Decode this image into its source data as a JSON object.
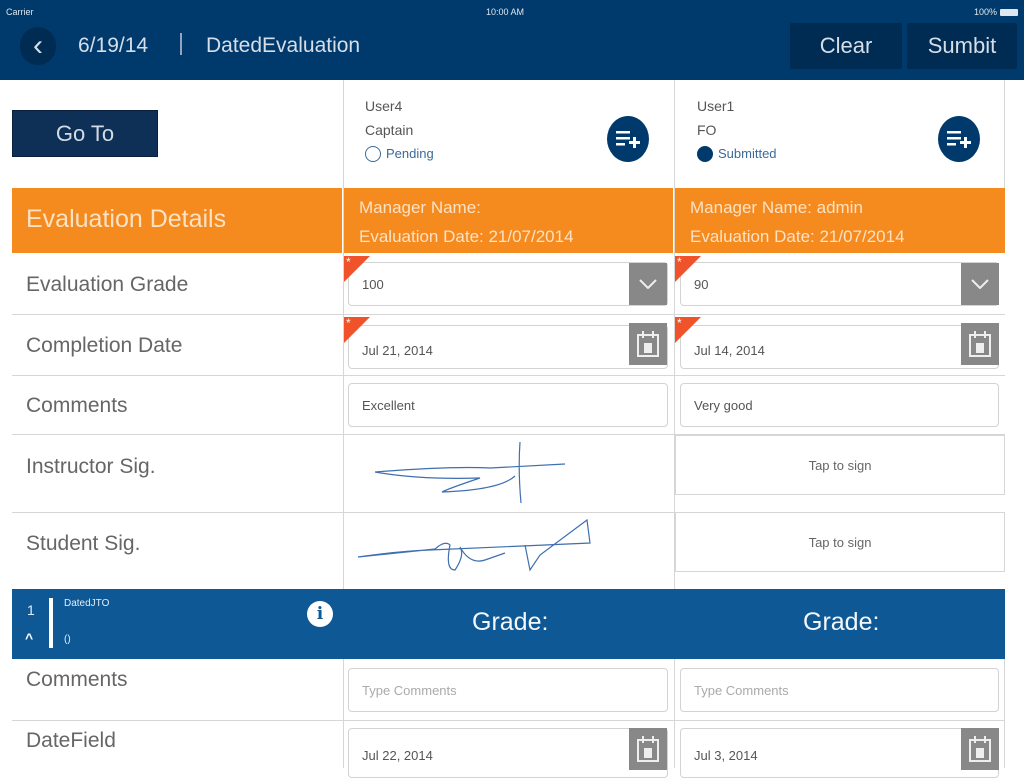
{
  "status_bar": {
    "carrier": "Carrier",
    "time": "10:00 AM",
    "battery": "100%"
  },
  "nav": {
    "date": "6/19/14",
    "title": "DatedEvaluation",
    "clear_label": "Clear",
    "submit_label": "Sumbit"
  },
  "goto_label": "Go To",
  "users": [
    {
      "name": "User4",
      "role": "Captain",
      "status": "Pending",
      "manager": "Manager Name:",
      "eval_date": "Evaluation Date: 21/07/2014"
    },
    {
      "name": "User1",
      "role": "FO",
      "status": "Submitted",
      "manager": "Manager Name: admin",
      "eval_date": "Evaluation Date: 21/07/2014"
    }
  ],
  "section_title": "Evaluation Details",
  "rows": {
    "grade": {
      "label": "Evaluation Grade",
      "values": [
        "100",
        "90"
      ]
    },
    "completion": {
      "label": "Completion Date",
      "values": [
        "Jul 21, 2014",
        "Jul 14, 2014"
      ]
    },
    "comments": {
      "label": "Comments",
      "values": [
        "Excellent",
        "Very good"
      ]
    },
    "instructor_sig": {
      "label": "Instructor Sig.",
      "tap_text": "Tap to sign"
    },
    "student_sig": {
      "label": "Student Sig.",
      "tap_text": "Tap to sign"
    }
  },
  "required_marker": "*",
  "subsection": {
    "number": "1",
    "name": "DatedJTO",
    "sub": "()",
    "grade_label": "Grade:",
    "comments_label": "Comments",
    "comments_placeholder": "Type Comments",
    "datefield_label": "DateField",
    "dates": [
      "Jul 22, 2014",
      "Jul 3, 2014"
    ]
  },
  "colors": {
    "navy": "#003a6c",
    "orange": "#f58a1f",
    "section_blue": "#0e5896",
    "required": "#f0522a"
  }
}
